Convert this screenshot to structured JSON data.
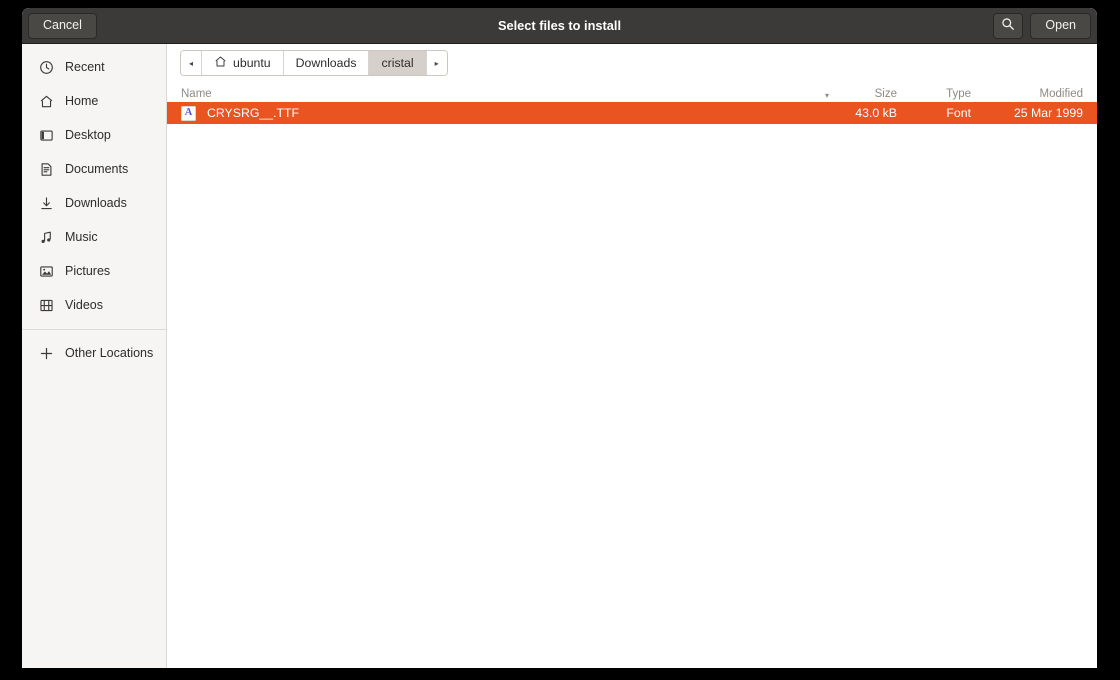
{
  "header": {
    "title": "Select files to install",
    "cancel_label": "Cancel",
    "open_label": "Open",
    "search_icon": "search-icon"
  },
  "sidebar": {
    "items": [
      {
        "label": "Recent",
        "icon": "clock-icon"
      },
      {
        "label": "Home",
        "icon": "home-icon"
      },
      {
        "label": "Desktop",
        "icon": "desktop-icon"
      },
      {
        "label": "Documents",
        "icon": "document-icon"
      },
      {
        "label": "Downloads",
        "icon": "download-icon"
      },
      {
        "label": "Music",
        "icon": "music-note-icon"
      },
      {
        "label": "Pictures",
        "icon": "image-icon"
      },
      {
        "label": "Videos",
        "icon": "film-icon"
      },
      {
        "label": "Other Locations",
        "icon": "plus-icon"
      }
    ]
  },
  "pathbar": {
    "back_arrow": "◂",
    "forward_arrow": "▸",
    "crumbs": [
      {
        "label": "ubuntu",
        "icon": "home-icon",
        "active": false
      },
      {
        "label": "Downloads",
        "icon": "",
        "active": false
      },
      {
        "label": "cristal",
        "icon": "",
        "active": true
      }
    ]
  },
  "filelist": {
    "columns": {
      "name": "Name",
      "sort_indicator": "▾",
      "size": "Size",
      "type": "Type",
      "modified": "Modified"
    },
    "rows": [
      {
        "name": "CRYSRG__.TTF",
        "size": "43.0 kB",
        "type": "Font",
        "modified": "25 Mar 1999",
        "icon_glyph": "A",
        "selected": true
      }
    ]
  },
  "colors": {
    "selection": "#e95420",
    "headerbar": "#3b3a38",
    "sidebar": "#f6f5f4",
    "font_icon_letter": "#5b55c8"
  }
}
